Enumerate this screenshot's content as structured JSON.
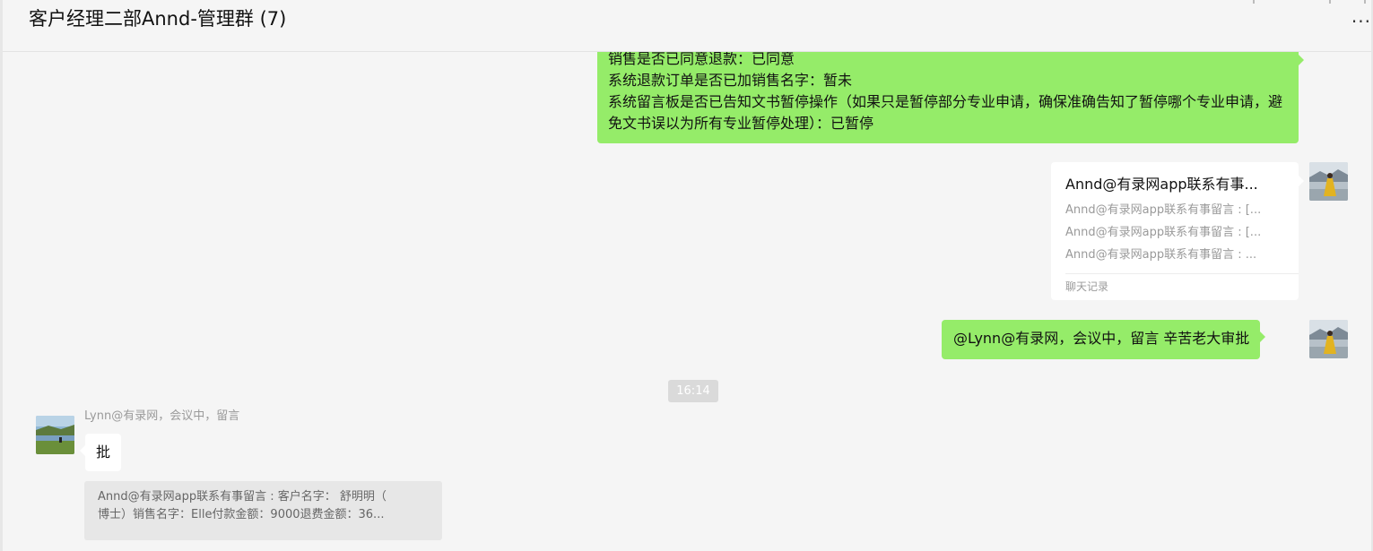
{
  "header": {
    "title": "客户经理二部Annd-管理群 (7)",
    "more_label": "···"
  },
  "messages": {
    "sent_long": {
      "line1": "销售是否已同意退款：已同意",
      "line2": "系统退款订单是否已加销售名字：暂未",
      "line3": "系统留言板是否已告知文书暂停操作（如果只是暂停部分专业申请，确保准确告知了暂停哪个专业申请，避免文书误以为所有专业暂停处理）：已暂停"
    },
    "forward_card": {
      "title": "Annd@有录网app联系有事...",
      "lines": [
        "Annd@有录网app联系有事留言 : [...",
        "Annd@有录网app联系有事留言 : [...",
        "Annd@有录网app联系有事留言 : ..."
      ],
      "footer": "聊天记录"
    },
    "sent_short": {
      "text": "@Lynn@有录网，会议中，留言 辛苦老大审批"
    },
    "timestamp": "16:14",
    "received": {
      "sender": "Lynn@有录网，会议中，留言",
      "text": "批",
      "quote_line1": "Annd@有录网app联系有事留言 : 客户名字： 舒明明（",
      "quote_line2": "博士）销售名字：Elle付款金额：9000退费金额：36..."
    }
  },
  "colors": {
    "self_bubble": "#95ec69",
    "other_bubble": "#ffffff",
    "background": "#f5f5f5"
  }
}
